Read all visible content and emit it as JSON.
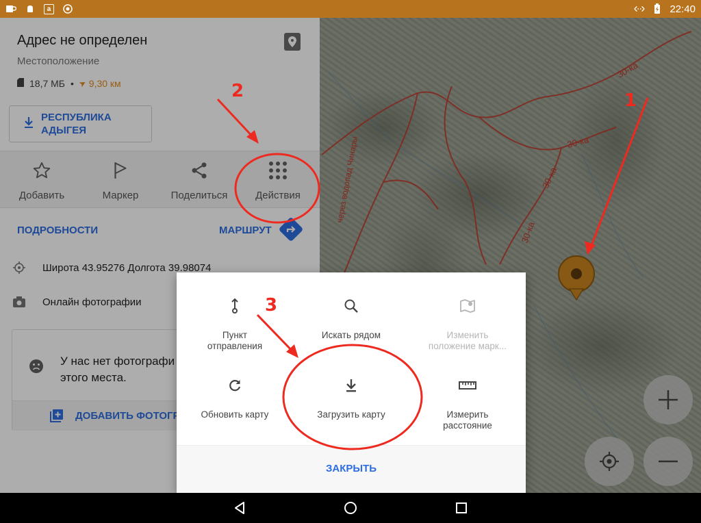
{
  "status_bar": {
    "time": "22:40",
    "left_icons": [
      "coffee-icon",
      "android-icon",
      "amazon-icon",
      "shield-icon"
    ],
    "right_icons": [
      "data-transfer-icon",
      "battery-charging-icon"
    ]
  },
  "place": {
    "title": "Адрес не определен",
    "subtitle": "Местоположение",
    "size": "18,7 МБ",
    "separator": "•",
    "distance": "9,30 км",
    "region_button": "РЕСПУБЛИКА АДЫГЕЯ"
  },
  "actions": [
    {
      "label": "Добавить",
      "icon": "star-outline-icon"
    },
    {
      "label": "Маркер",
      "icon": "flag-outline-icon"
    },
    {
      "label": "Поделиться",
      "icon": "share-icon"
    },
    {
      "label": "Действия",
      "icon": "dots-grid-icon"
    }
  ],
  "links": {
    "details": "ПОДРОБНОСТИ",
    "route": "МАРШРУТ"
  },
  "info": {
    "coords": "Широта 43.95276 Долгота 39.98074",
    "photos": "Онлайн фотографии"
  },
  "photo_card": {
    "message": "У нас нет фотографи этого места.",
    "add_button": "ДОБАВИТЬ ФОТОГР"
  },
  "map": {
    "trail_labels": [
      "30-ка",
      "30-ка",
      "30-ка",
      "30-ка",
      "через водопад Чинары"
    ]
  },
  "dialog": {
    "items": [
      {
        "label": "Пункт отправления",
        "icon": "start-point-icon",
        "enabled": true
      },
      {
        "label": "Искать рядом",
        "icon": "search-icon",
        "enabled": true
      },
      {
        "label": "Изменить положение марк...",
        "icon": "map-edit-icon",
        "enabled": false
      },
      {
        "label": "Обновить карту",
        "icon": "refresh-icon",
        "enabled": true
      },
      {
        "label": "Загрузить карту",
        "icon": "download-icon",
        "enabled": true
      },
      {
        "label": "Измерить расстояние",
        "icon": "ruler-icon",
        "enabled": true
      }
    ],
    "close": "ЗАКРЫТЬ"
  },
  "annotations": {
    "numbers": [
      "1",
      "2",
      "3"
    ],
    "color": "#ee2a20"
  },
  "colors": {
    "accent": "#2d6de0",
    "status_bar": "#b8731f",
    "distance": "#e08a1e",
    "marker": "#c8841e",
    "trail": "#c0392b"
  }
}
